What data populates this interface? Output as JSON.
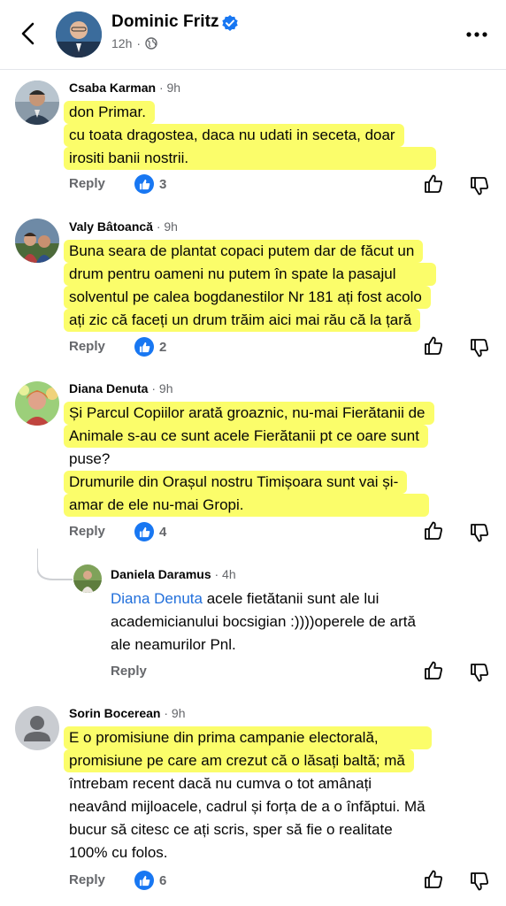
{
  "header": {
    "author": "Dominic Fritz",
    "time": "12h",
    "meta_separator": "·"
  },
  "comments": [
    {
      "author": "Csaba Karman",
      "time": "· 9h",
      "lines": [
        "don Primar.",
        "cu toata dragostea, daca nu udati in seceta, doar",
        "irositi banii nostrii."
      ],
      "reply_label": "Reply",
      "likes": "3"
    },
    {
      "author": "Valy Bâtoancă",
      "time": "· 9h",
      "lines": [
        "Buna seara de plantat copaci putem dar de făcut un",
        "drum pentru oameni nu putem în spate la pasajul",
        "solventul pe calea bogdanestilor Nr 181 ați fost acolo",
        "ați zic că faceți un drum trăim aici mai rău că la țară"
      ],
      "reply_label": "Reply",
      "likes": "2"
    },
    {
      "author": "Diana Denuta",
      "time": "· 9h",
      "lines": [
        "Și Parcul Copiilor arată groaznic, nu-mai  Fierătanii de",
        "Animale s-au ce sunt acele Fierătanii pt ce oare sunt",
        "puse?",
        "Drumurile din Orașul nostru Timișoara sunt vai și-",
        "amar de ele nu-mai Gropi."
      ],
      "reply_label": "Reply",
      "likes": "4"
    },
    {
      "author": "Daniela Daramus",
      "time": "· 4h",
      "mention": "Diana Denuta",
      "lines": [
        " acele fietătanii sunt ale lui",
        "academicianului bocsigian :))))operele de artă",
        "ale neamurilor Pnl."
      ],
      "reply_label": "Reply"
    },
    {
      "author": "Sorin Bocerean",
      "time": "· 9h",
      "lines": [
        "E o promisiune din prima campanie electorală,",
        "promisiune pe care am crezut că o lăsați baltă; mă",
        "întrebam recent dacă nu cumva o tot amânați",
        "neavând mijloacele, cadrul și forța de a o înfăptui. Mă",
        "bucur să citesc ce ați scris, sper să fie o realitate",
        "100% cu folos."
      ],
      "reply_label": "Reply",
      "likes": "6"
    }
  ],
  "colors": {
    "highlight": "#fbfd6a",
    "like_blue": "#1877f2",
    "mention": "#216fdb",
    "meta_gray": "#65676b"
  }
}
